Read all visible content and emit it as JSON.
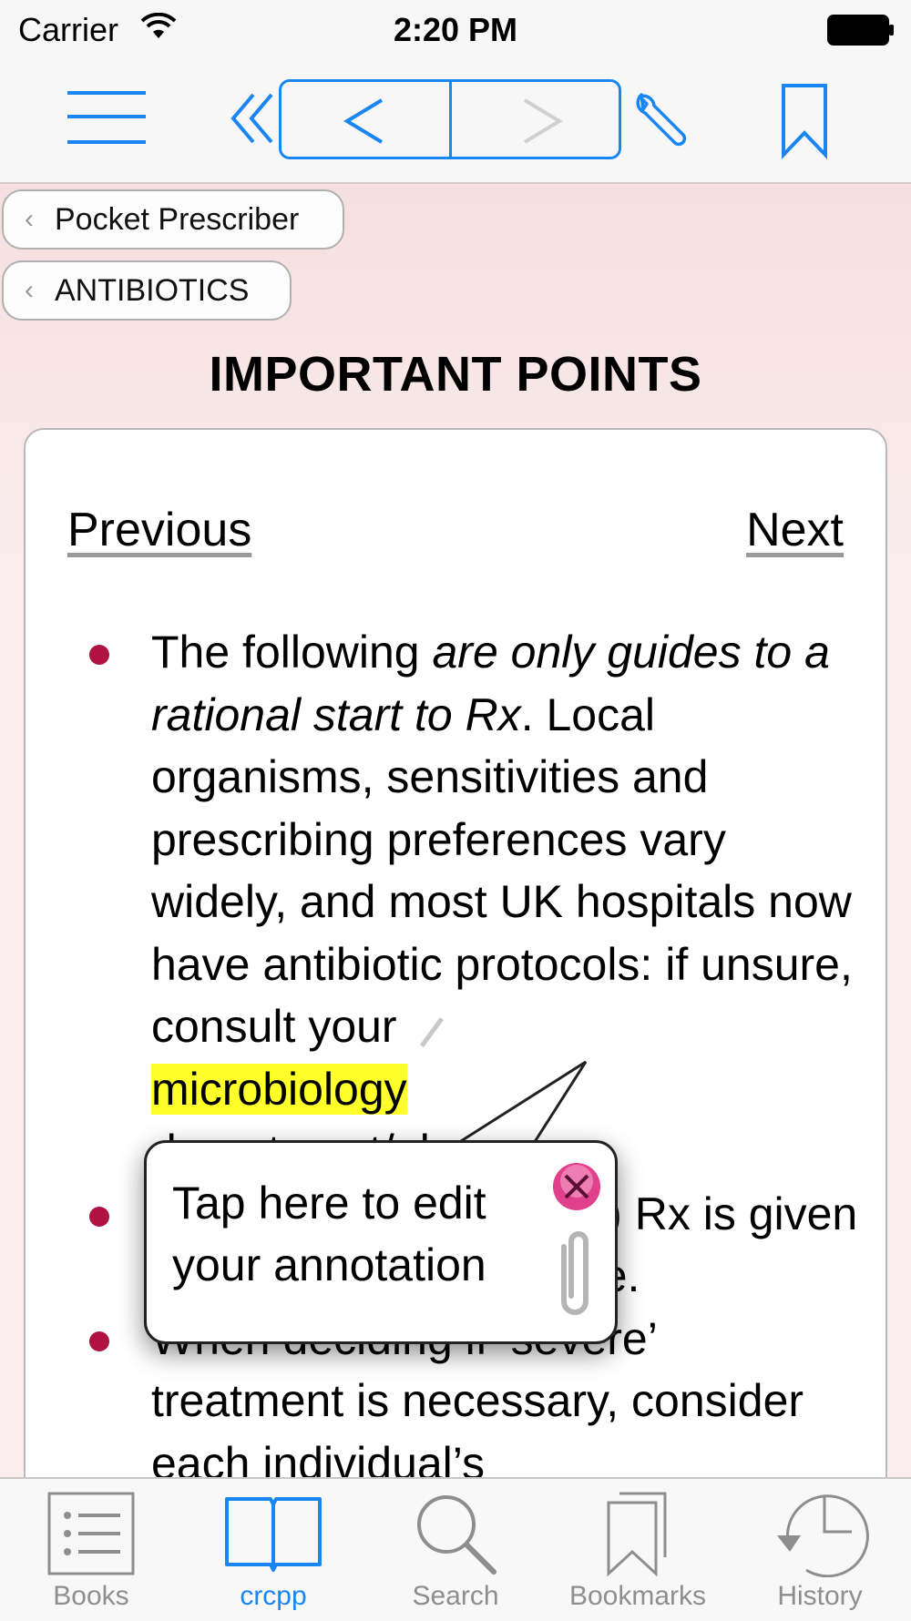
{
  "status_bar": {
    "carrier": "Carrier",
    "time": "2:20 PM"
  },
  "nav_bar": {
    "icons": [
      "menu-icon",
      "double-chevron-left-icon",
      "chevron-left-icon",
      "chevron-right-icon",
      "wrench-icon",
      "bookmark-icon"
    ],
    "accent_color": "#1a86f3"
  },
  "breadcrumbs": [
    {
      "label": "Pocket Prescriber"
    },
    {
      "label": "ANTIBIOTICS"
    }
  ],
  "page_title": "IMPORTANT POINTS",
  "pager": {
    "previous": "Previous",
    "next": "Next"
  },
  "bullets": {
    "b1": {
      "text1": "The following ",
      "italic": "are only guides to a rational start to Rx",
      "text2": ". Local organisms, sensitivities and prescribing preferences vary widely, and most UK hospitals now have antibiotic protocols: if unsure, consult your ",
      "highlight": "microbiology",
      "text3": " department/pharmacy."
    },
    "b2": {
      "text": "Empirical (‘best guess’) Rx is given unless stated otherwise."
    },
    "b3": {
      "text": "When deciding if ‘severe’ treatment is necessary, consider each individual’s"
    }
  },
  "annotation_popup": {
    "text": "Tap here to edit your annotation"
  },
  "tab_bar": {
    "tabs": [
      {
        "label": "Books",
        "icon": "list-icon"
      },
      {
        "label": "crcpp",
        "icon": "open-book-icon",
        "active": true
      },
      {
        "label": "Search",
        "icon": "search-icon"
      },
      {
        "label": "Bookmarks",
        "icon": "bookmarks-icon"
      },
      {
        "label": "History",
        "icon": "history-icon"
      }
    ]
  },
  "colors": {
    "bullet": "#b01244",
    "highlight": "#ffff2a",
    "background": "#f9eded"
  }
}
